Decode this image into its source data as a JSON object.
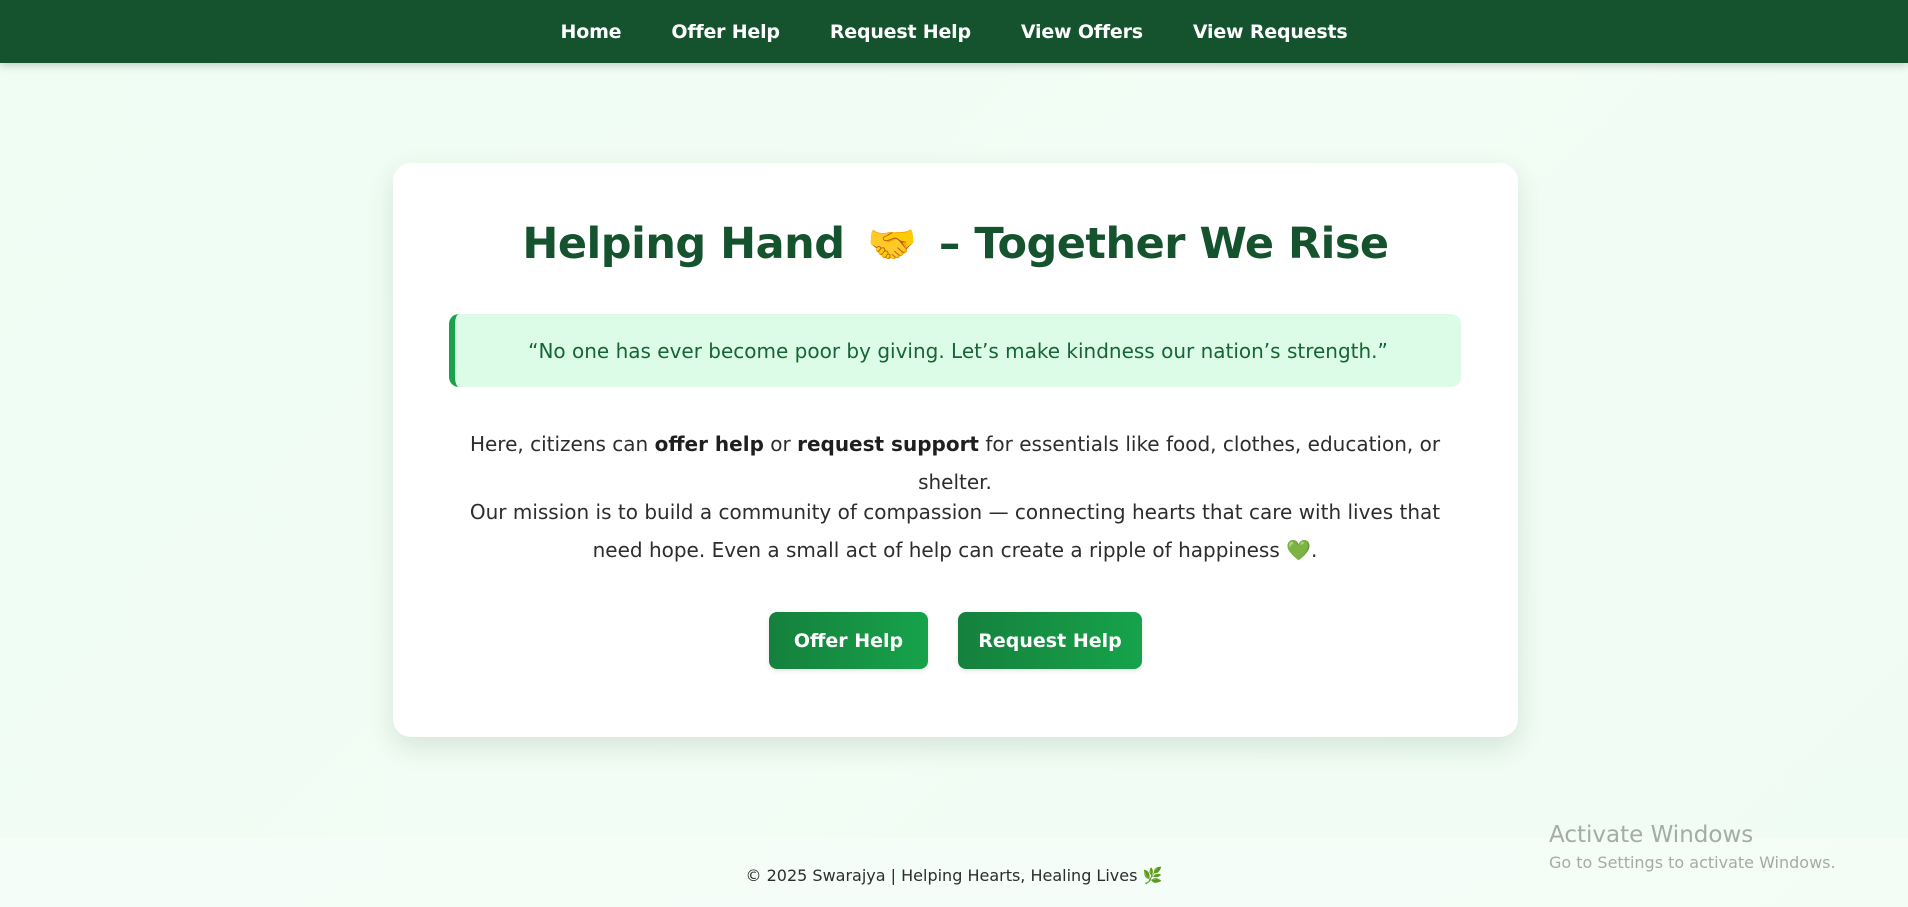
{
  "nav": {
    "items": [
      {
        "label": "Home"
      },
      {
        "label": "Offer Help"
      },
      {
        "label": "Request Help"
      },
      {
        "label": "View Offers"
      },
      {
        "label": "View Requests"
      }
    ]
  },
  "hero": {
    "title_left": "Helping Hand",
    "title_emoji": "🤝",
    "title_right": "– Together We Rise",
    "quote": "“No one has ever become poor by giving. Let’s make kindness our nation’s strength.”",
    "para1": {
      "part1": "Here, citizens can ",
      "bold1": "offer help",
      "part2": " or ",
      "bold2": "request support",
      "part3": " for essentials like food, clothes, education, or shelter."
    },
    "para2": {
      "text": "Our mission is to build a community of compassion — connecting hearts that care with lives that need hope. Even a small act of help can create a ripple of happiness ",
      "emoji": "💚",
      "end": "."
    },
    "buttons": {
      "offer_label": "Offer Help",
      "request_label": "Request Help"
    }
  },
  "footer": {
    "text": "© 2025 Swarajya | Helping Hearts, Healing Lives",
    "emoji": "🌿"
  },
  "watermark": {
    "title": "Activate Windows",
    "subtitle": "Go to Settings to activate Windows."
  },
  "colors": {
    "nav_bg": "#14532d",
    "title": "#14532d",
    "accent": "#16a34a",
    "quote_bg": "#dcfce7",
    "page_bg": "#effdf3"
  }
}
